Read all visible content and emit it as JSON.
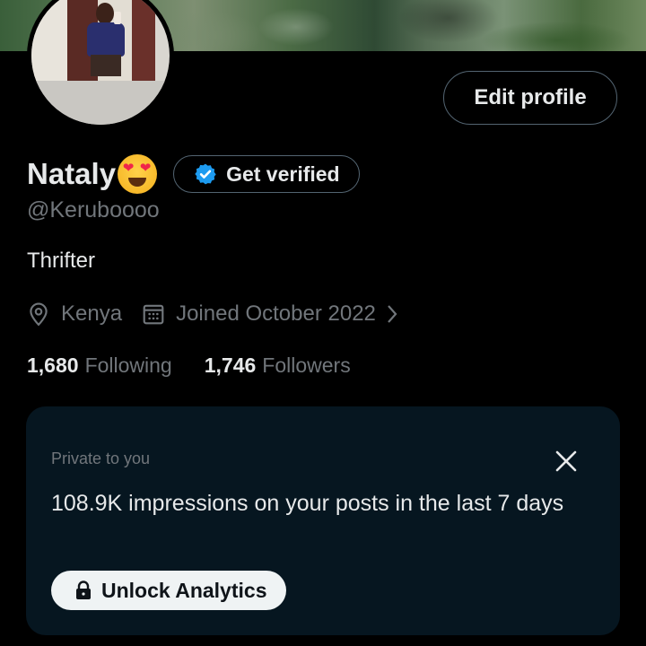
{
  "header": {
    "edit_profile_label": "Edit profile"
  },
  "profile": {
    "name": "Nataly",
    "name_emoji": "smiling-face-with-heart-eyes",
    "get_verified_label": "Get verified",
    "handle": "@Keruboooo",
    "bio": "Thrifter",
    "location": "Kenya",
    "joined": "Joined October 2022",
    "following_count": "1,680",
    "following_label": "Following",
    "followers_count": "1,746",
    "followers_label": "Followers"
  },
  "analytics_card": {
    "private_label": "Private to you",
    "message": "108.9K impressions on your posts in the last 7 days",
    "unlock_label": "Unlock Analytics"
  },
  "colors": {
    "background": "#000000",
    "primary_text": "#e7e9ea",
    "secondary_text": "#71767b",
    "border": "#536471",
    "verified_blue": "#1d9bf0",
    "card_background": "#061620"
  }
}
